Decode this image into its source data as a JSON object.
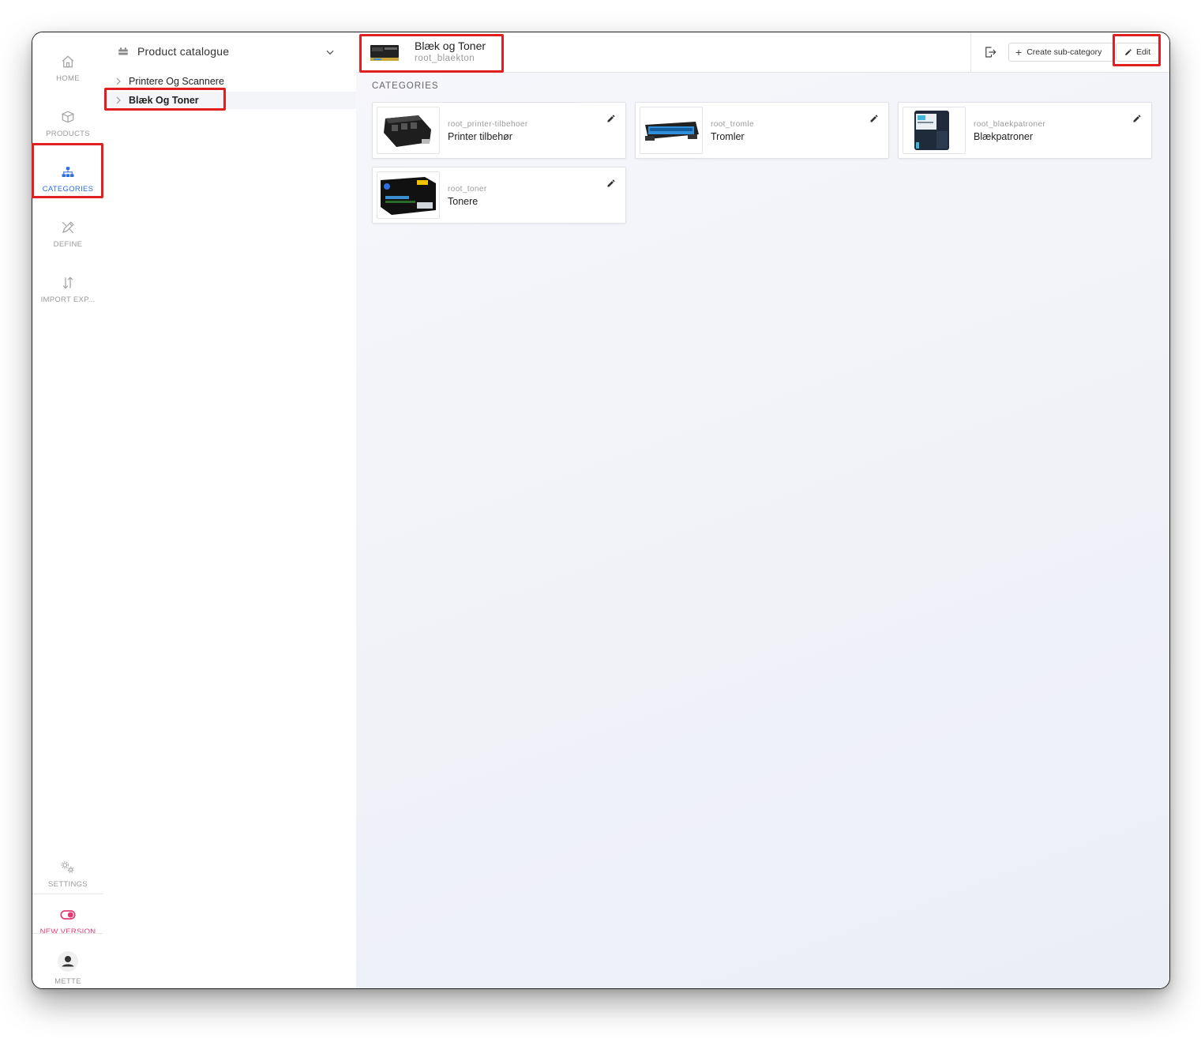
{
  "rail": {
    "items": [
      {
        "label": "HOME",
        "icon": "home-icon"
      },
      {
        "label": "PRODUCTS",
        "icon": "box-icon"
      },
      {
        "label": "CATEGORIES",
        "icon": "hierarchy-icon"
      },
      {
        "label": "DEFINE",
        "icon": "pencil-ruler-icon"
      },
      {
        "label": "IMPORT EXP...",
        "icon": "swap-vertical-icon"
      }
    ],
    "settings_label": "SETTINGS",
    "new_version_label": "NEW VERSION",
    "user_label": "METTE"
  },
  "tree": {
    "title": "Product catalogue",
    "nodes": [
      {
        "label": "Printere Og Scannere"
      },
      {
        "label": "Blæk Og Toner"
      }
    ]
  },
  "header": {
    "title": "Blæk og Toner",
    "code": "root_blaekton",
    "create_label": "Create sub-category",
    "edit_label": "Edit"
  },
  "main": {
    "section_label": "CATEGORIES",
    "cards": [
      {
        "code": "root_printer-tilbehoer",
        "name": "Printer tilbehør"
      },
      {
        "code": "root_tromle",
        "name": "Tromler"
      },
      {
        "code": "root_blaekpatroner",
        "name": "Blækpatroner"
      },
      {
        "code": "root_toner",
        "name": "Tonere"
      }
    ]
  },
  "colors": {
    "accent": "#2f6fe0",
    "new_version": "#e23b73",
    "highlight": "#e02020"
  }
}
